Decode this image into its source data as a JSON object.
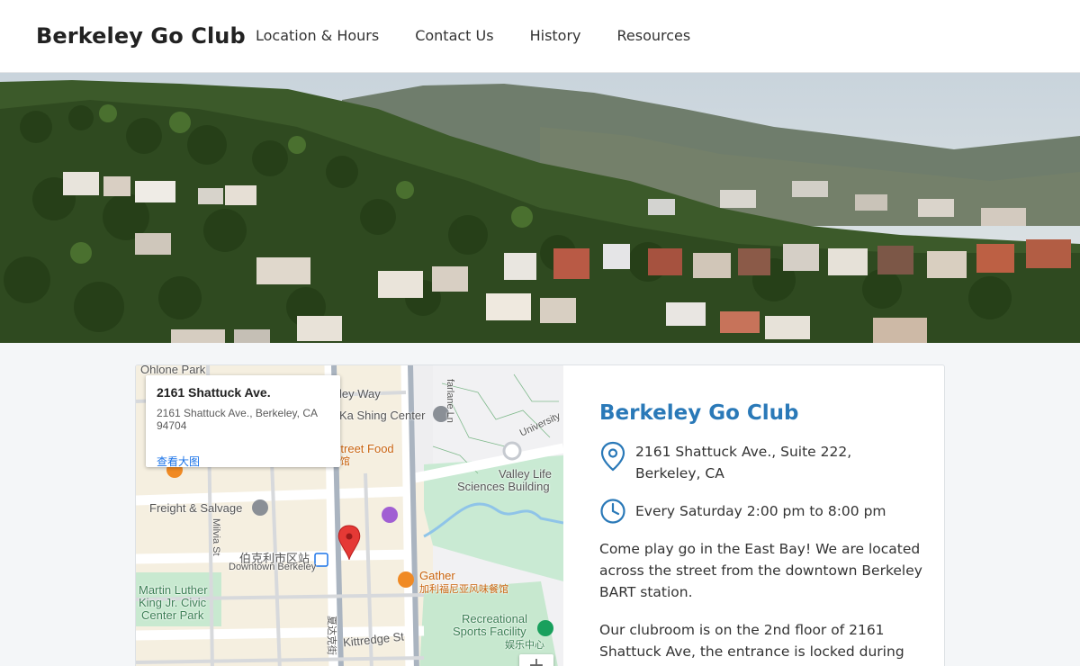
{
  "header": {
    "brand": "Berkeley Go Club",
    "nav": [
      "Location & Hours",
      "Contact Us",
      "History",
      "Resources"
    ]
  },
  "map": {
    "popup": {
      "title": "2161 Shattuck Ave.",
      "address": "2161 Shattuck Ave., Berkeley, CA 94704",
      "link": "查看大图"
    },
    "labels": {
      "ohlone_park": "Ohlone Park",
      "hearst_way": "ley Way",
      "ka_shing": "Ka Shing Center",
      "farlane": "farlane Ln",
      "university": "University",
      "street_food": "ai Street Food",
      "street_food_cn": "馆",
      "valley_life": "Valley Life",
      "sciences_building": "Sciences Building",
      "freight_salvage": "Freight & Salvage",
      "milvia": "Milvia St",
      "downtown_cn": "伯克利市区站",
      "downtown_berkeley": "Downtown Berkeley",
      "mlk1": "Martin Luther",
      "mlk2": "King Jr. Civic",
      "mlk3": "Center Park",
      "gather": "Gather",
      "gather_cn": "加利福尼亚风味餐馆",
      "rec1": "Recreational",
      "rec2": "Sports Facility",
      "rec_cn": "娱乐中心",
      "shattuck_cn": "夏达克街",
      "kittredge": "Kittredge St"
    },
    "zoom_label": "+"
  },
  "info": {
    "title": "Berkeley Go Club",
    "address_line1": "2161 Shattuck Ave., Suite 222,",
    "address_line2": "Berkeley, CA",
    "hours": "Every Saturday 2:00 pm to 8:00 pm",
    "para1": "Come play go in the East Bay! We are located across the street from the downtown Berkeley BART station.",
    "para2": "Our clubroom is on the 2nd floor of 2161 Shattuck Ave, the entrance is locked during"
  },
  "colors": {
    "brand_blue": "#2a79b8",
    "marker_red": "#e53935",
    "park_green": "#c7e8cf"
  }
}
